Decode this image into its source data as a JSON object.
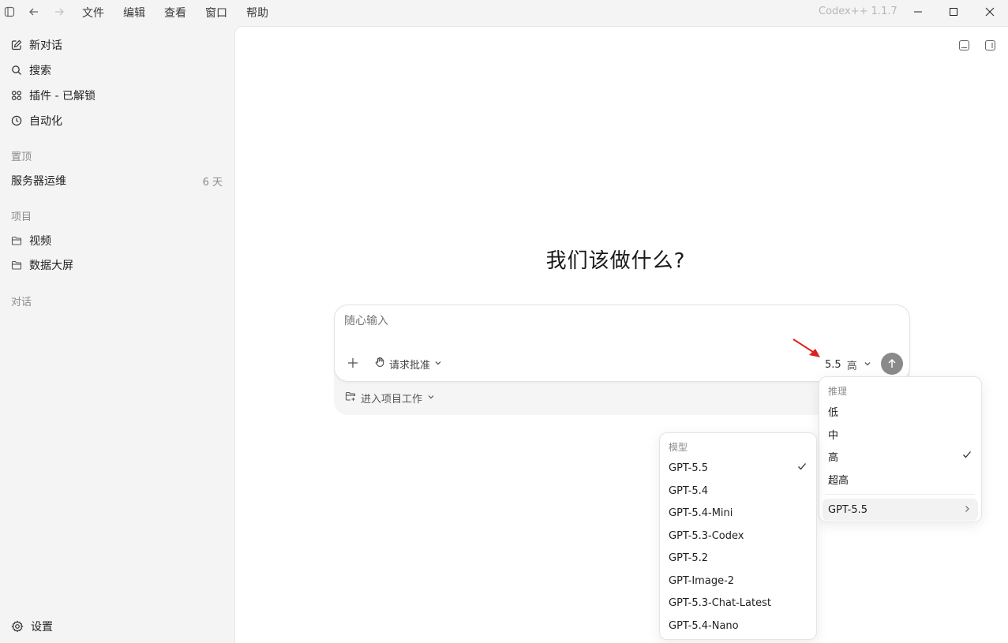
{
  "titlebar": {
    "menus": [
      "文件",
      "编辑",
      "查看",
      "窗口",
      "帮助"
    ],
    "app_version": "Codex++ 1.1.7",
    "icons": [
      "sidebar-toggle-icon",
      "back-icon",
      "forward-icon",
      "minimize-icon",
      "maximize-icon",
      "close-icon"
    ]
  },
  "sidebar": {
    "nav": [
      {
        "label": "新对话",
        "icon": "edit-icon"
      },
      {
        "label": "搜索",
        "icon": "search-icon"
      },
      {
        "label": "插件 - 已解锁",
        "icon": "plugins-icon"
      },
      {
        "label": "自动化",
        "icon": "clock-icon"
      }
    ],
    "pinned_label": "置顶",
    "pinned": [
      {
        "title": "服务器运维",
        "age": "6 天"
      }
    ],
    "projects_label": "项目",
    "projects": [
      {
        "label": "视频"
      },
      {
        "label": "数据大屏"
      }
    ],
    "chats_label": "对话",
    "settings_label": "设置"
  },
  "main": {
    "title": "我们该做什么?",
    "composer": {
      "placeholder": "随心输入",
      "approval_label": "请求批准",
      "model_version": "5.5",
      "reasoning": "高"
    },
    "project_button": "进入项目工作"
  },
  "reasoning_menu": {
    "label": "推理",
    "items": [
      "低",
      "中",
      "高",
      "超高"
    ],
    "selected": "高",
    "model_submenu": "GPT-5.5"
  },
  "model_menu": {
    "label": "模型",
    "items": [
      "GPT-5.5",
      "GPT-5.4",
      "GPT-5.4-Mini",
      "GPT-5.3-Codex",
      "GPT-5.2",
      "GPT-Image-2",
      "GPT-5.3-Chat-Latest",
      "GPT-5.4-Nano"
    ],
    "selected": "GPT-5.5"
  },
  "colors": {
    "annotation_arrow": "#e02020",
    "send_button": "#8a8a8a"
  }
}
